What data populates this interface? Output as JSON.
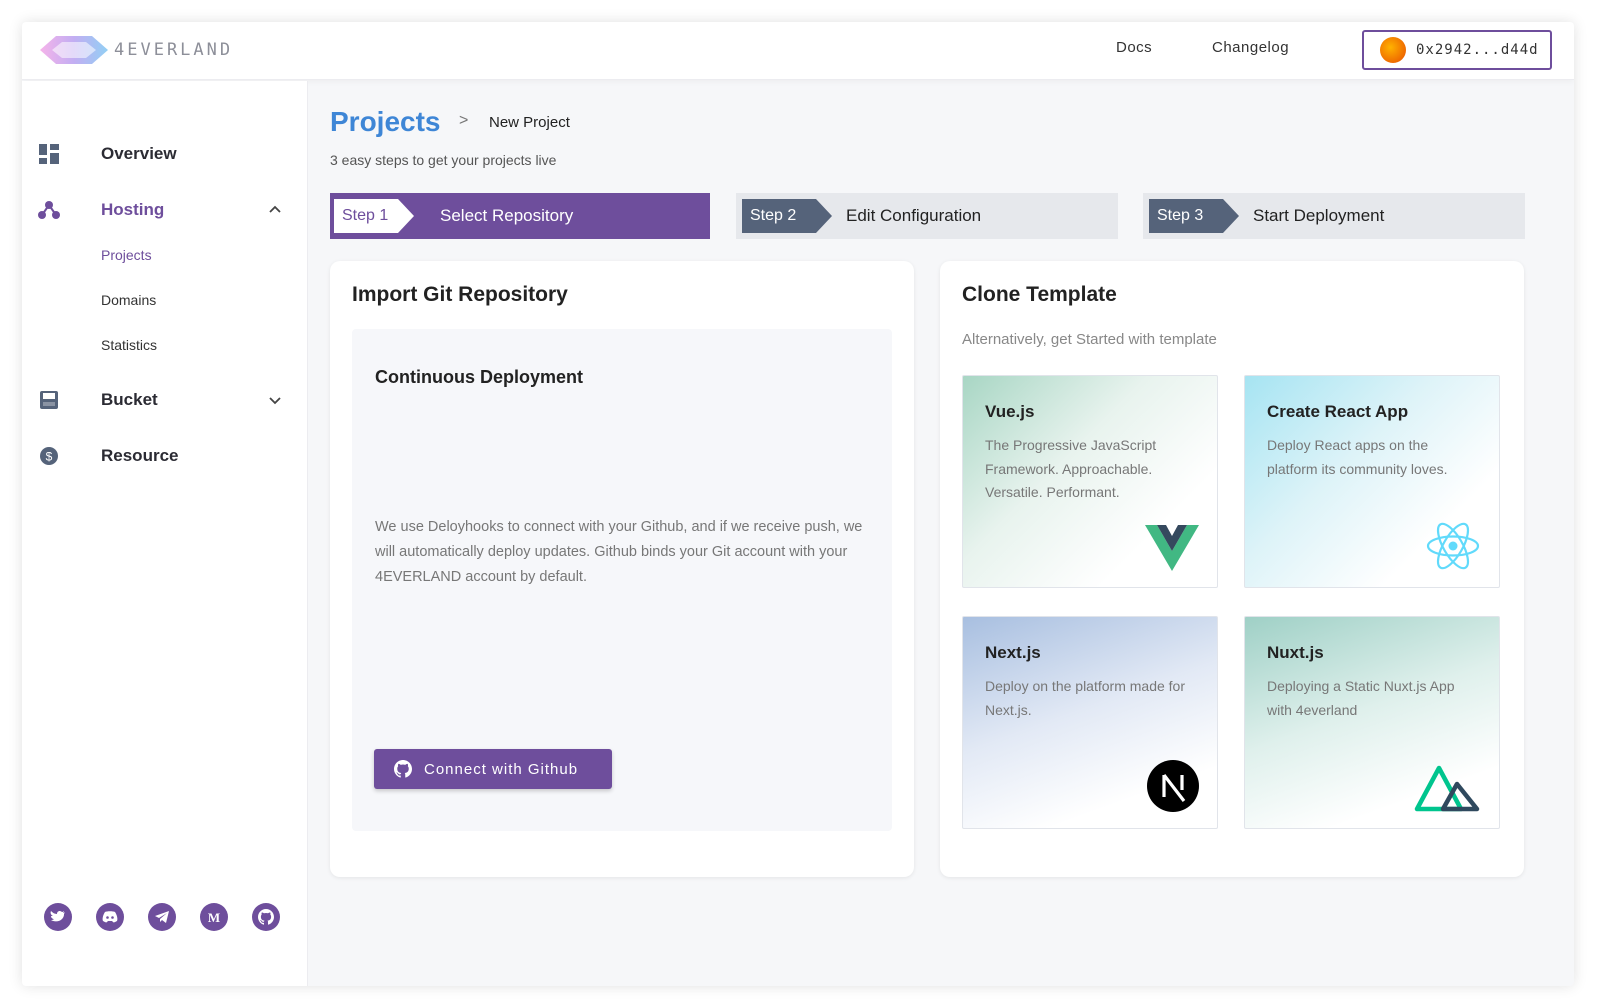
{
  "header": {
    "logo_text": "4EVERLAND",
    "nav": {
      "docs": "Docs",
      "changelog": "Changelog"
    },
    "wallet_address": "0x2942...d44d"
  },
  "sidebar": {
    "items": [
      {
        "label": "Overview",
        "icon": "dashboard-icon"
      },
      {
        "label": "Hosting",
        "icon": "hosting-icon",
        "expanded": true,
        "children": [
          "Projects",
          "Domains",
          "Statistics"
        ]
      },
      {
        "label": "Bucket",
        "icon": "bucket-icon",
        "expanded": false
      },
      {
        "label": "Resource",
        "icon": "resource-icon"
      }
    ],
    "socials": [
      "twitter-icon",
      "discord-icon",
      "telegram-icon",
      "medium-icon",
      "github-icon"
    ]
  },
  "breadcrumb": {
    "root": "Projects",
    "separator": ">",
    "current": "New Project"
  },
  "subtitle": "3 easy steps to get your projects live",
  "steps": [
    {
      "tag": "Step 1",
      "label": "Select Repository",
      "active": true
    },
    {
      "tag": "Step 2",
      "label": "Edit Configuration",
      "active": false
    },
    {
      "tag": "Step 3",
      "label": "Start Deployment",
      "active": false
    }
  ],
  "import_panel": {
    "title": "Import Git Repository",
    "section_title": "Continuous Deployment",
    "description": "We use Deloyhooks to connect with your Github, and if we receive push, we will automatically deploy updates. Github binds your Git account with your 4EVERLAND account by default.",
    "button": "Connect with Github"
  },
  "clone_panel": {
    "title": "Clone Template",
    "subtitle": "Alternatively, get Started with template",
    "templates": [
      {
        "title": "Vue.js",
        "desc": "The Progressive JavaScript Framework. Approachable. Versatile. Performant.",
        "icon": "vue-logo-icon"
      },
      {
        "title": "Create React App",
        "desc": "Deploy React apps on the platform its community loves.",
        "icon": "react-logo-icon"
      },
      {
        "title": "Next.js",
        "desc": "Deploy on the platform made for Next.js.",
        "icon": "nextjs-logo-icon"
      },
      {
        "title": "Nuxt.js",
        "desc": "Deploying a Static Nuxt.js App with 4everland",
        "icon": "nuxt-logo-icon"
      }
    ]
  },
  "colors": {
    "brand": "#6e4e9c",
    "link_blue": "#3e86d6",
    "step_tag": "#55637a"
  }
}
